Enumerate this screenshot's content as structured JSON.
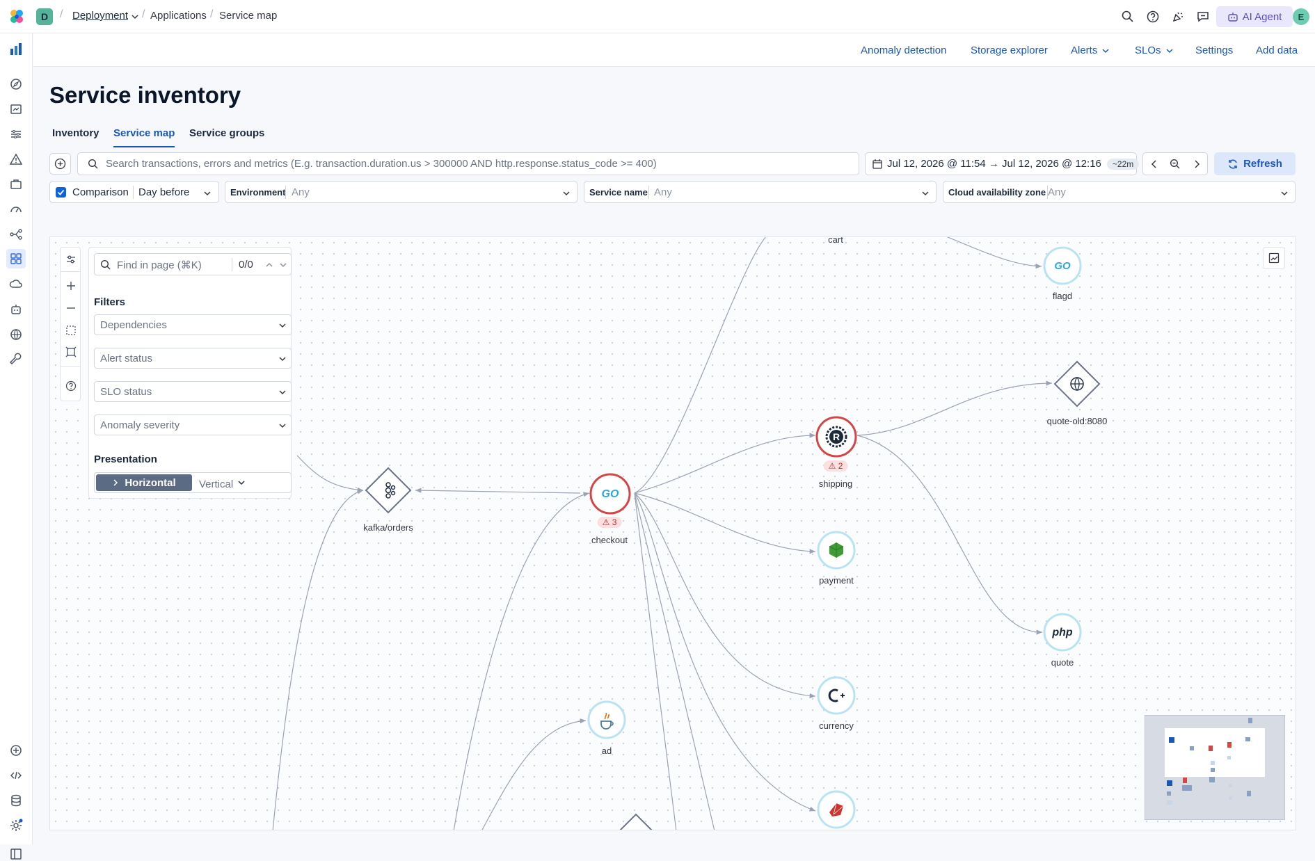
{
  "breadcrumbs": {
    "space": "D",
    "items": [
      "Deployment",
      "Applications",
      "Service map"
    ]
  },
  "topbar": {
    "ai_agent": "AI Agent",
    "avatar": "E"
  },
  "app_header": {
    "links": [
      "Anomaly detection",
      "Storage explorer",
      "Alerts",
      "SLOs",
      "Settings",
      "Add data"
    ]
  },
  "page": {
    "title": "Service inventory"
  },
  "tabs": [
    "Inventory",
    "Service map",
    "Service groups"
  ],
  "search": {
    "placeholder": "Search transactions, errors and metrics (E.g. transaction.duration.us > 300000 AND http.response.status_code >= 400)"
  },
  "time": {
    "range": "Jul 12, 2026 @ 11:54 → Jul 12, 2026 @ 12:16",
    "duration": "~22m",
    "refresh": "Refresh"
  },
  "comparison": {
    "label": "Comparison",
    "value": "Day before",
    "checked": true
  },
  "filters": {
    "environment": {
      "label": "Environment",
      "value": "Any"
    },
    "service_name": {
      "label": "Service name",
      "value": "Any"
    },
    "zone": {
      "label": "Cloud availability zone",
      "value": "Any"
    }
  },
  "panel": {
    "find_placeholder": "Find in page (⌘K)",
    "find_count": "0/0",
    "filters_title": "Filters",
    "selects": [
      "Dependencies",
      "Alert status",
      "SLO status",
      "Anomaly severity"
    ],
    "presentation_title": "Presentation",
    "horizontal": "Horizontal",
    "vertical": "Vertical"
  },
  "nodes": {
    "cart": "cart",
    "flagd": "flagd",
    "quote_old": "quote-old:8080",
    "shipping": "shipping",
    "shipping_alerts": "2",
    "kafka": "kafka/orders",
    "checkout": "checkout",
    "checkout_alerts": "3",
    "payment": "payment",
    "quote": "quote",
    "currency": "currency",
    "ad": "ad"
  },
  "colors": {
    "accent": "#1a57b8",
    "alert": "#d64545",
    "go": "#29a9db"
  }
}
